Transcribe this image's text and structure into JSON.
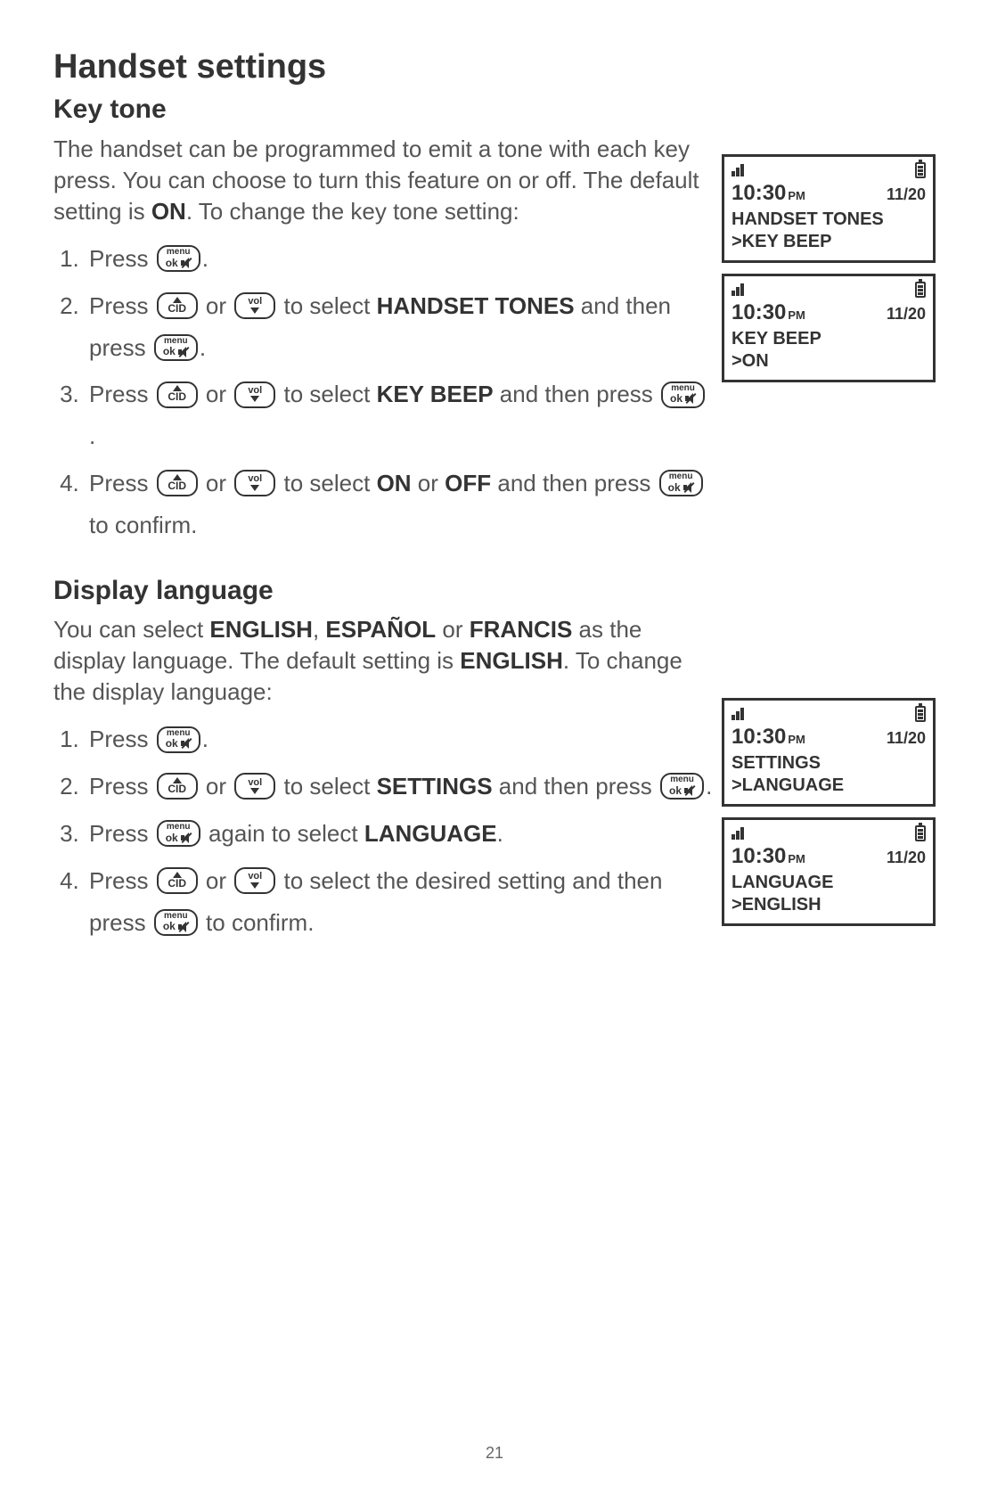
{
  "title": "Handset settings",
  "sections": {
    "keytone": {
      "heading": "Key tone",
      "intro_pre": "The handset can be programmed to emit a tone with each key press. You can choose to turn this feature on or off. The default setting is ",
      "intro_bold": "ON",
      "intro_post": ". To change the key tone setting:",
      "steps": {
        "1": "Press ",
        "2a": "Press ",
        "2b": " or ",
        "2c": " to select ",
        "2d": "HANDSET TONES",
        "2e": " and then press ",
        "3a": "Press ",
        "3b": " or ",
        "3c": " to select ",
        "3d": "KEY BEEP",
        "3e": " and then press ",
        "4a": "Press ",
        "4b": " or ",
        "4c": " to select ",
        "4d": "ON",
        "4e": " or ",
        "4f": "OFF",
        "4g": " and then press ",
        "4h": " to confirm."
      }
    },
    "language": {
      "heading": "Display language",
      "intro_a": "You can select ",
      "intro_b": "ENGLISH",
      "intro_c": ", ",
      "intro_d": "ESPAÑOL",
      "intro_e": " or ",
      "intro_f": "FRANCIS",
      "intro_g": " as the display language. The default setting is ",
      "intro_h": "ENGLISH",
      "intro_i": ". To change the display language:",
      "steps": {
        "1": "Press ",
        "2a": "Press ",
        "2b": " or ",
        "2c": " to select ",
        "2d": "SETTINGS",
        "2e": " and then press ",
        "3a": "Press ",
        "3b": " again to select ",
        "3c": "LANGUAGE",
        "4a": "Press ",
        "4b": " or ",
        "4c": " to select the desired setting and then press ",
        "4d": " to confirm."
      }
    }
  },
  "key_labels": {
    "menu_top": "menu",
    "menu_ok": "ok",
    "cid": "CID",
    "vol": "vol"
  },
  "screens": {
    "common": {
      "time": "10:30",
      "ampm": "PM",
      "date": "11/20"
    },
    "s1": {
      "line1": "HANDSET TONES",
      "line2": ">KEY BEEP"
    },
    "s2": {
      "line1": "KEY BEEP",
      "line2": ">ON"
    },
    "s3": {
      "line1": "SETTINGS",
      "line2": ">LANGUAGE"
    },
    "s4": {
      "line1": "LANGUAGE",
      "line2": ">ENGLISH"
    }
  },
  "page_number": "21"
}
